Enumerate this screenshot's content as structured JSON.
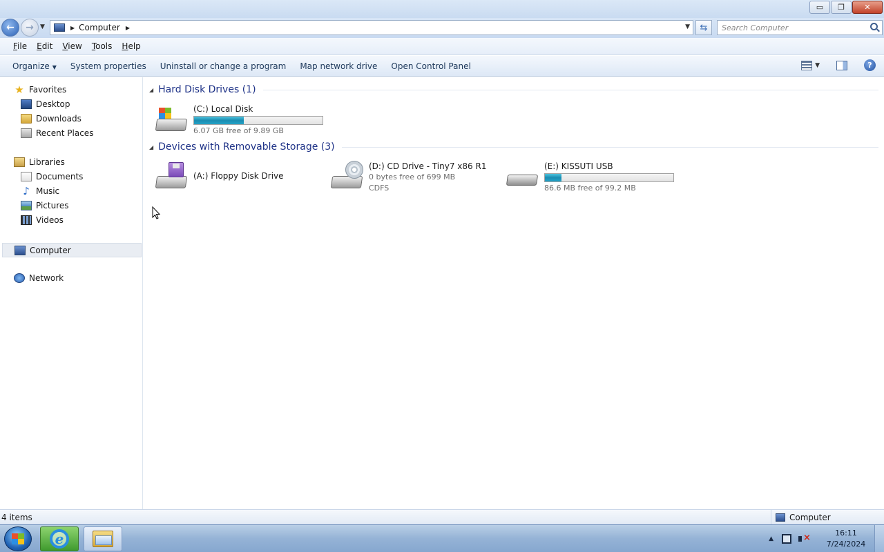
{
  "window": {
    "minimize": "▭",
    "restore": "❐",
    "close": "✕"
  },
  "address": {
    "location": "Computer",
    "search_placeholder": "Search Computer"
  },
  "menu": {
    "file": {
      "acc": "F",
      "rest": "ile"
    },
    "edit": {
      "acc": "E",
      "rest": "dit"
    },
    "view": {
      "acc": "V",
      "rest": "iew"
    },
    "tools": {
      "acc": "T",
      "rest": "ools"
    },
    "help": {
      "acc": "H",
      "rest": "elp"
    }
  },
  "commands": {
    "organize": "Organize",
    "system_properties": "System properties",
    "uninstall": "Uninstall or change a program",
    "map_drive": "Map network drive",
    "control_panel": "Open Control Panel"
  },
  "navpane": {
    "favorites": "Favorites",
    "desktop": "Desktop",
    "downloads": "Downloads",
    "recent": "Recent Places",
    "libraries": "Libraries",
    "documents": "Documents",
    "music": "Music",
    "pictures": "Pictures",
    "videos": "Videos",
    "computer": "Computer",
    "network": "Network"
  },
  "groups": {
    "hdd": "Hard Disk Drives (1)",
    "removable": "Devices with Removable Storage (3)"
  },
  "drives": {
    "c": {
      "name": "(C:) Local Disk",
      "free": "6.07 GB free of 9.89 GB",
      "used_fraction": 0.386
    },
    "a": {
      "name": "(A:) Floppy Disk Drive"
    },
    "d": {
      "name": "(D:) CD Drive - Tiny7 x86 R1",
      "free": "0 bytes free of 699 MB",
      "fs": "CDFS"
    },
    "e": {
      "name": "(E:) KISSUTI USB",
      "free": "86.6 MB free of 99.2 MB",
      "used_fraction": 0.127
    }
  },
  "status": {
    "count": "4 items",
    "location": "Computer"
  },
  "tray": {
    "time": "16:11",
    "date": "7/24/2024"
  },
  "colors": {
    "group_header": "#1e3287",
    "bar_fill": "#1a8cb1",
    "command_text": "#1e395b"
  }
}
